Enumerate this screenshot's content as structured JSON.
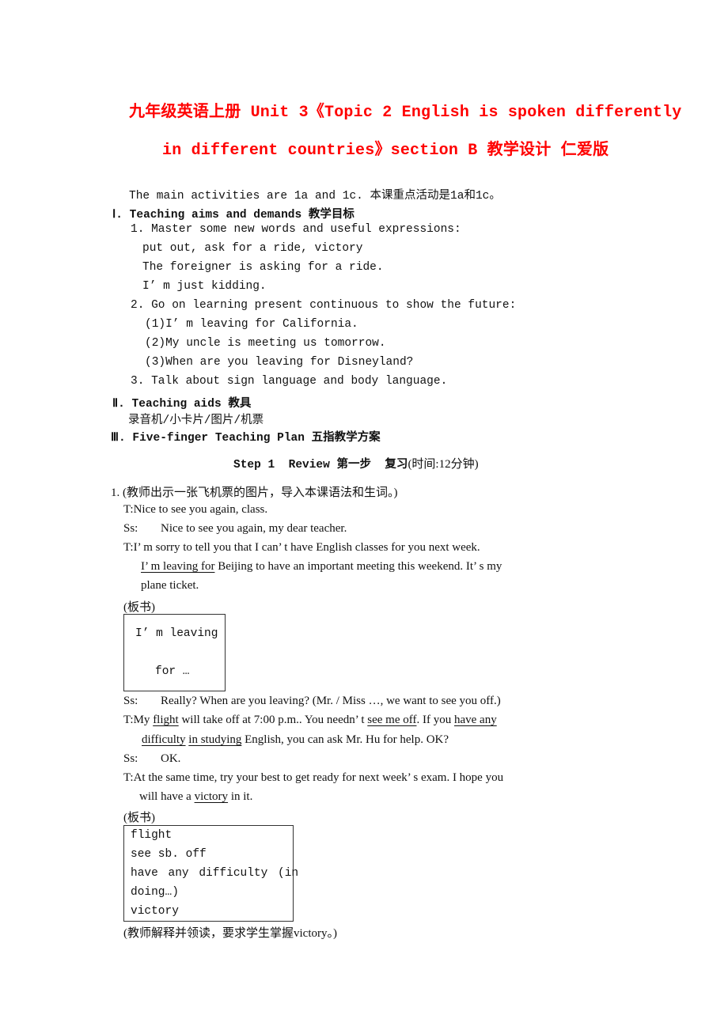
{
  "document": {
    "title_line1": "九年级英语上册 Unit 3《Topic 2 English is spoken differently",
    "title_line2": "in different countries》section B 教学设计 仁爱版",
    "intro": "The main activities are 1a and 1c. 本课重点活动是1a和1c。",
    "section1": {
      "heading": "Ⅰ. Teaching aims and demands 教学目标",
      "items": [
        "1. Master some new words and useful expressions:",
        "put out, ask for a ride, victory",
        "The foreigner is asking for a ride.",
        "I’ m just kidding.",
        "2. Go on learning present continuous to show the future:",
        "(1)I’ m leaving for California.",
        "(2)My uncle is meeting us tomorrow.",
        "(3)When are you leaving for Disneyland?",
        "3. Talk about sign language and body language."
      ]
    },
    "section2": {
      "heading": "Ⅱ. Teaching aids 教具",
      "content": "录音机/小卡片/图片/机票"
    },
    "section3": {
      "heading": "Ⅲ. Five-finger Teaching Plan 五指教学方案"
    },
    "step1": {
      "heading_bold": "Step 1  Review 第一步  复习",
      "heading_time": "(时间:12分钟)",
      "intro": "1. (教师出示一张飞机票的图片，导入本课语法和生词。)",
      "dialogue": [
        {
          "speaker": "T:",
          "text": "Nice to see you again, class."
        },
        {
          "speaker": "Ss:",
          "text": "Nice to see you again, my dear teacher."
        },
        {
          "speaker": "T:",
          "text": "I’ m sorry to tell you that I can’ t have English classes for you next week."
        }
      ],
      "line4_underlined": "I’ m leaving for",
      "line4_rest": " Beijing to have an important meeting this weekend. It’ s my",
      "line5": "plane ticket.",
      "board_label_1": "(板书)",
      "board1": {
        "line1": "I’ m leaving",
        "line2": "for …"
      },
      "ss_really": {
        "speaker": "Ss:",
        "text": "Really? When are you leaving? (Mr. / Miss …, we want to see you off.)"
      },
      "t_flight": {
        "speaker": "T:",
        "p1": "My ",
        "u1": "flight",
        "p2": " will take off at 7:00 p.m.. You needn’ t ",
        "u2": "see me off",
        "p3": ". If you ",
        "u3": "have any",
        "u4": "difficulty",
        "p4": " ",
        "u5": "in studying",
        "p5": " English, you can ask Mr. Hu for help. OK?"
      },
      "ss_ok": {
        "speaker": "Ss:",
        "text": "OK."
      },
      "t_same": {
        "speaker": "T:",
        "line1": "At the same time, try your best to get ready for next week’ s exam. I hope you",
        "p1": "will have a ",
        "u1": "victory",
        "p2": " in it."
      },
      "board_label_2": "(板书)",
      "board2": [
        "flight",
        "see sb. off",
        "have any difficulty (in",
        "doing…)",
        "victory"
      ],
      "closing": "(教师解释并领读，要求学生掌握victory。)"
    }
  }
}
